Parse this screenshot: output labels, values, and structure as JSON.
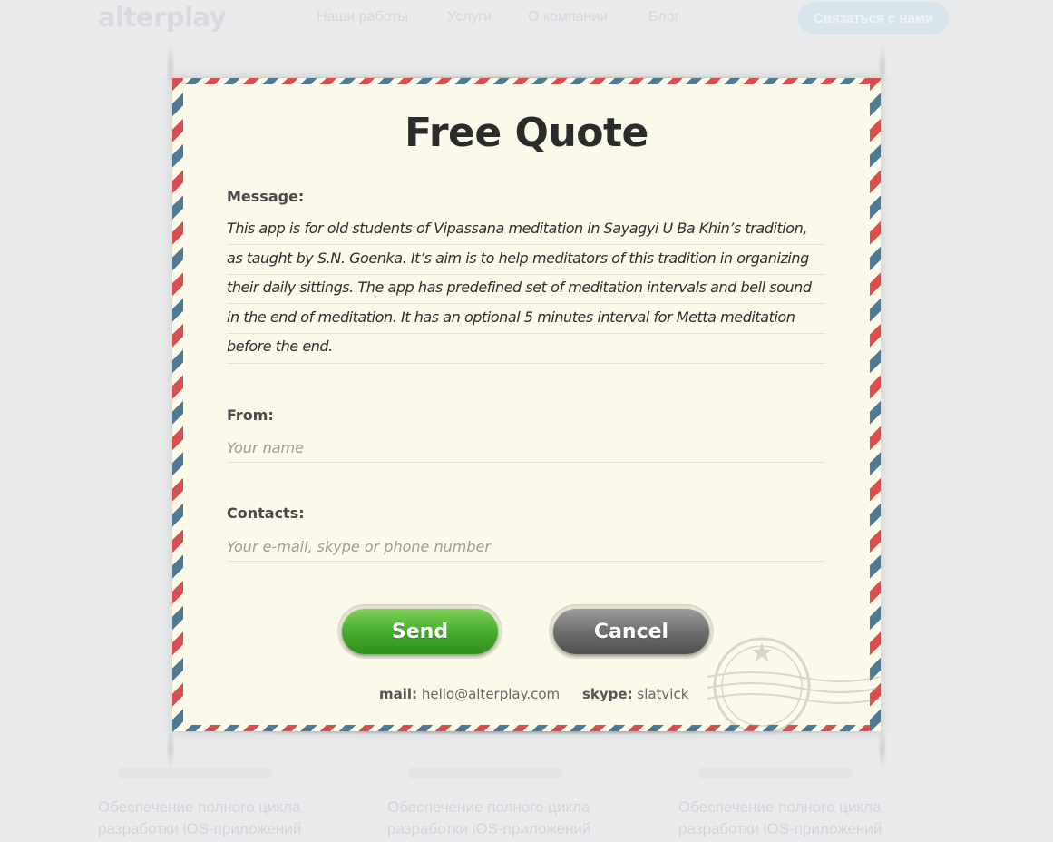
{
  "background": {
    "logo": "alterplay",
    "nav": [
      "Наши работы",
      "Услуги",
      "О компании",
      "Блог"
    ],
    "contact_button": "Связаться с нами",
    "columns": [
      "Обеспечение полного цикла разработки iOS-приложений",
      "Обеспечение полного цикла разработки iOS-приложений",
      "Обеспечение полного цикла разработки iOS-приложений"
    ]
  },
  "form": {
    "title": "Free Quote",
    "message_label": "Message:",
    "message_text": "This app is for old students of Vipassana meditation in Sayagyi U Ba Khin’s tradition, as taught by S.N. Goenka. It’s aim is to help meditators of this tradition in organizing their daily sittings. The app has predefined set of meditation intervals and bell sound in the end of meditation. It has an optional 5 minutes interval for Metta meditation before the end.",
    "from_label": "From:",
    "from_placeholder": "Your name",
    "contacts_label": "Contacts:",
    "contacts_placeholder": "Your e-mail, skype or phone number",
    "send_label": "Send",
    "cancel_label": "Cancel"
  },
  "footer": {
    "mail_label": "mail:",
    "mail_value": "hello@alterplay.com",
    "skype_label": "skype:",
    "skype_value": "slatvick"
  },
  "colors": {
    "paper": "#fbf9e9",
    "stripe_red": "#d94f4f",
    "stripe_blue": "#4f7a94",
    "send": "#43a92a",
    "cancel": "#6c6c6c"
  }
}
